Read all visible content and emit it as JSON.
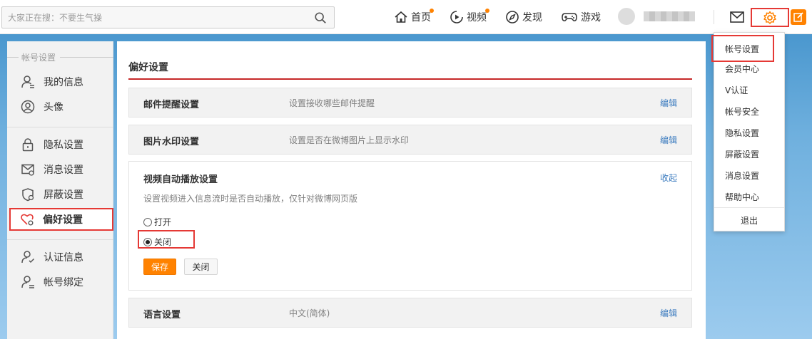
{
  "search": {
    "placeholder": "大家正在搜：不要生气操"
  },
  "nav": {
    "home": "首页",
    "video": "视频",
    "discover": "发现",
    "game": "游戏"
  },
  "colors": {
    "accent": "#ff8200",
    "highlight": "#e53935",
    "link": "#3b7bbf"
  },
  "sidebar": {
    "section_title": "帐号设置",
    "items": [
      {
        "label": "我的信息",
        "icon": "user-info-icon"
      },
      {
        "label": "头像",
        "icon": "avatar-icon"
      },
      {
        "label": "隐私设置",
        "icon": "lock-icon"
      },
      {
        "label": "消息设置",
        "icon": "message-icon"
      },
      {
        "label": "屏蔽设置",
        "icon": "shield-icon"
      },
      {
        "label": "偏好设置",
        "icon": "heart-gear-icon",
        "active": true
      },
      {
        "label": "认证信息",
        "icon": "verify-icon"
      },
      {
        "label": "帐号绑定",
        "icon": "bind-icon"
      }
    ]
  },
  "main": {
    "title": "偏好设置",
    "rows": [
      {
        "label": "邮件提醒设置",
        "desc": "设置接收哪些邮件提醒",
        "action": "编辑"
      },
      {
        "label": "图片水印设置",
        "desc": "设置是否在微博图片上显示水印",
        "action": "编辑"
      }
    ],
    "video": {
      "label": "视频自动播放设置",
      "action": "收起",
      "desc": "设置视频进入信息流时是否自动播放，仅针对微博网页版",
      "option_on": "打开",
      "option_off": "关闭",
      "selected": "关闭",
      "save": "保存",
      "close": "关闭"
    },
    "language": {
      "label": "语言设置",
      "desc": "中文(简体)",
      "action": "编辑"
    }
  },
  "dropdown": {
    "items": [
      "帐号设置",
      "会员中心",
      "V认证",
      "帐号安全",
      "隐私设置",
      "屏蔽设置",
      "消息设置",
      "帮助中心"
    ],
    "logout": "退出"
  }
}
